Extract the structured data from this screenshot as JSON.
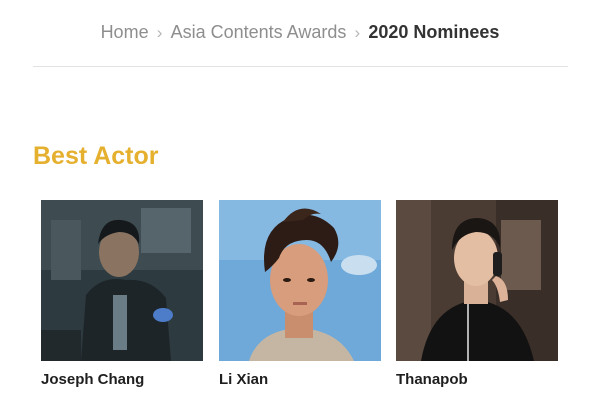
{
  "breadcrumb": {
    "items": [
      {
        "label": "Home"
      },
      {
        "label": "Asia Contents Awards"
      },
      {
        "label": "2020 Nominees",
        "current": true
      }
    ],
    "separator": ">"
  },
  "section": {
    "title": "Best Actor",
    "title_color": "#e6b02f"
  },
  "nominees": [
    {
      "name": "Joseph Chang"
    },
    {
      "name": "Li Xian"
    },
    {
      "name": "Thanapob"
    }
  ]
}
